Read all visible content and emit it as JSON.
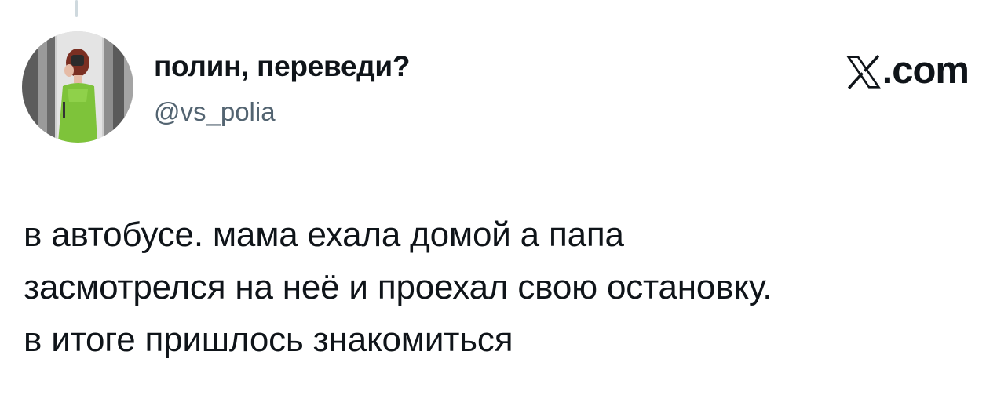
{
  "tweet": {
    "display_name": "полин, переведи?",
    "handle": "@vs_polia",
    "brand_logo": "x-logo-icon",
    "brand_suffix": ".com",
    "text_lines": [
      "в автобусе. мама ехала домой а папа",
      "засмотрелся на неё и проехал свою остановку.",
      "в итоге пришлось знакомиться"
    ]
  },
  "colors": {
    "text": "#0f1419",
    "secondary": "#536471",
    "thread_line": "#cfd9de",
    "background": "#ffffff"
  }
}
